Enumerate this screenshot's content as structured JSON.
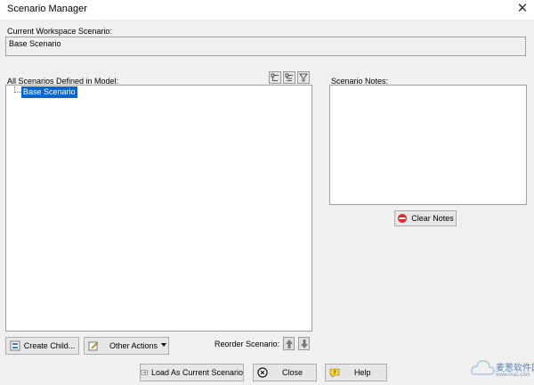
{
  "window": {
    "title": "Scenario Manager",
    "close_glyph": "✕"
  },
  "workspace": {
    "label": "Current Workspace Scenario:",
    "value": "Base Scenario"
  },
  "scenarios": {
    "label": "All Scenarios Defined in Model:",
    "items": [
      "Base Scenario"
    ],
    "selected": "Base Scenario"
  },
  "notes": {
    "label": "Scenario Notes:",
    "clear_label": "Clear Notes"
  },
  "actions": {
    "create_child_label": "Create Child...",
    "other_actions_label": "Other Actions",
    "reorder_label": "Reorder Scenario:"
  },
  "footer": {
    "load_label": "Load As Current Scenario",
    "close_label": "Close",
    "help_label": "Help"
  },
  "watermark": {
    "line1": "麦葱软件园",
    "line2": "www.mac.com"
  }
}
